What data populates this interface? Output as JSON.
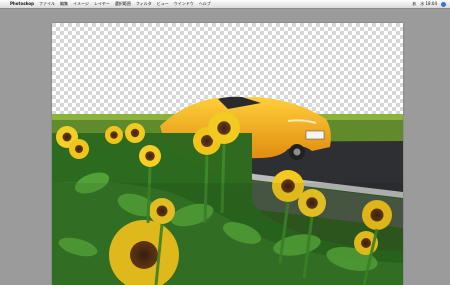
{
  "app": {
    "name": "Photoshop"
  },
  "menubar": {
    "items": [
      {
        "label": "ファイル"
      },
      {
        "label": "編集"
      },
      {
        "label": "イメージ"
      },
      {
        "label": "レイヤー"
      },
      {
        "label": "選択範囲"
      },
      {
        "label": "フィルタ"
      },
      {
        "label": "ビュー"
      },
      {
        "label": "ウインドウ"
      },
      {
        "label": "ヘルプ"
      }
    ],
    "status": {
      "battery": "あ",
      "time": "水 18:04"
    }
  },
  "document": {
    "content": "Photo of an orange convertible sports car parked on a road behind sunflowers; sky area removed (transparent checkerboard)."
  }
}
